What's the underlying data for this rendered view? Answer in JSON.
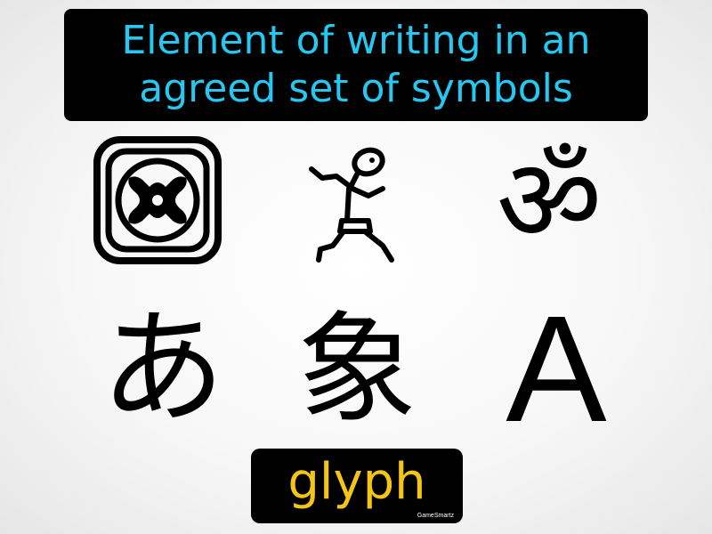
{
  "definition": {
    "text": "Element of writing in an agreed set of symbols",
    "color": "#25c8f0"
  },
  "glyphs": [
    {
      "name": "mayan-glyph-icon"
    },
    {
      "name": "egyptian-running-man-hieroglyph-icon"
    },
    {
      "name": "om-symbol-icon",
      "char": "ॐ"
    },
    {
      "name": "hiragana-a-character",
      "char": "あ"
    },
    {
      "name": "kanji-elephant-character",
      "char": "象"
    },
    {
      "name": "latin-capital-a-character",
      "char": "A"
    }
  ],
  "term": {
    "text": "glyph",
    "color": "#f4c514",
    "brand": "GameSmartz"
  }
}
